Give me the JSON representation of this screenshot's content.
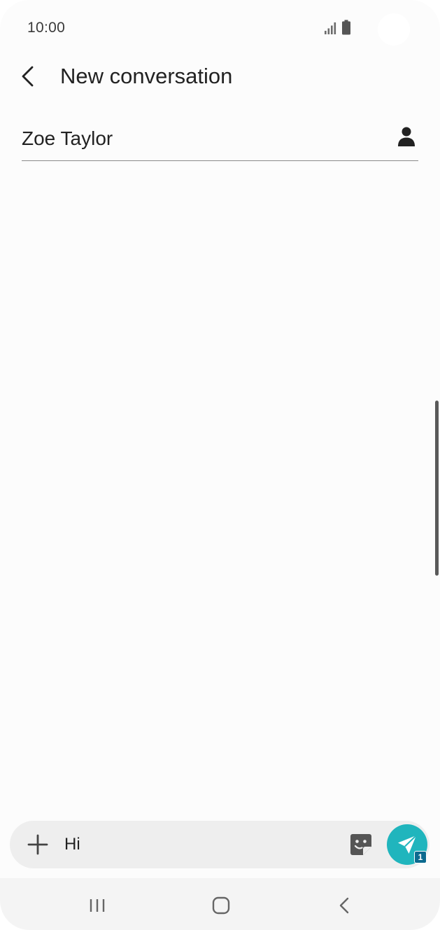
{
  "status_bar": {
    "time": "10:00",
    "icons": [
      "signal-icon",
      "battery-icon"
    ]
  },
  "header": {
    "title": "New conversation",
    "back_icon": "chevron-left-icon"
  },
  "recipient": {
    "name": "Zoe Taylor",
    "contact_icon": "person-icon"
  },
  "composer": {
    "message_value": "Hi",
    "add_icon": "plus-icon",
    "sticker_icon": "sticker-icon",
    "send_icon": "send-icon",
    "sim_badge": "1",
    "send_color": "#20b5bd"
  },
  "nav_bar": {
    "icons": [
      "recents-icon",
      "home-icon",
      "back-icon"
    ]
  }
}
